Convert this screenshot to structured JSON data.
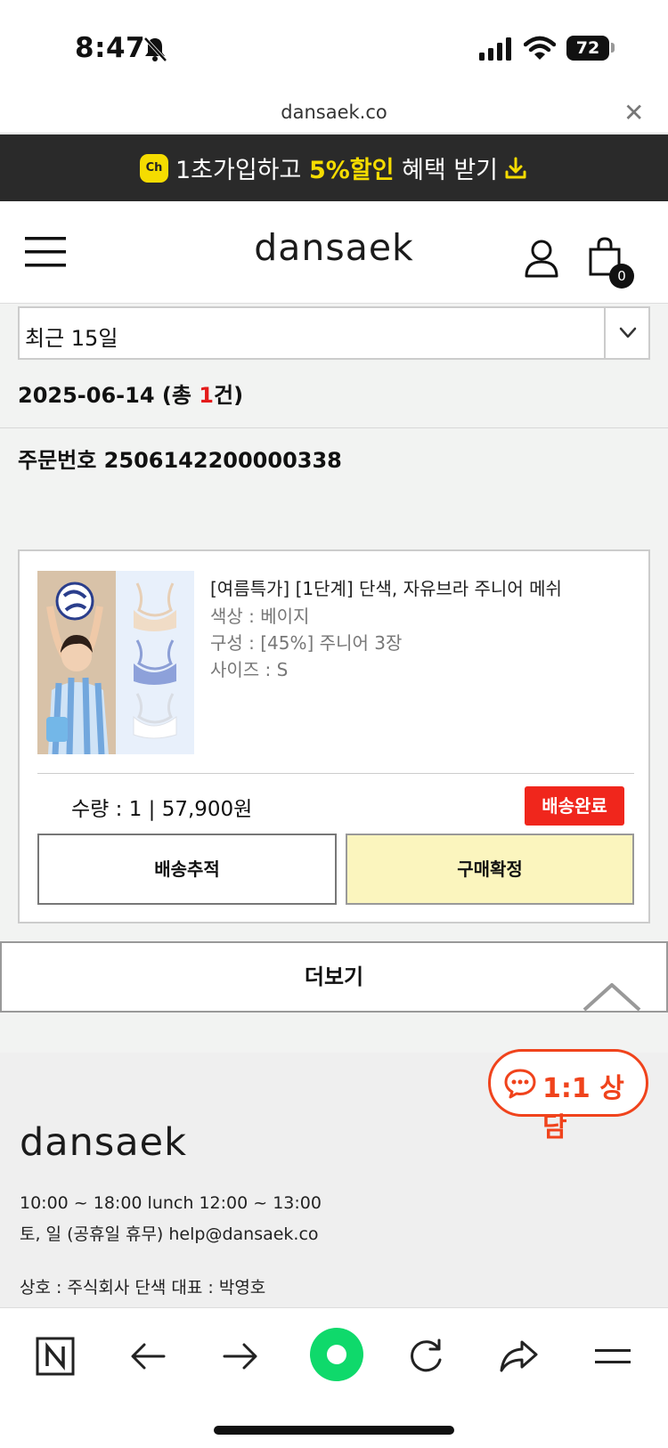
{
  "status_bar": {
    "time": "8:47",
    "battery": "72"
  },
  "url_bar": {
    "domain": "dansaek.co"
  },
  "promo": {
    "ch_badge": "Ch",
    "prefix": "1초가입하고 ",
    "highlight": "5%할인",
    "suffix": " 혜택 받기"
  },
  "header": {
    "logo": "dansaek",
    "cart_count": "0"
  },
  "filter": {
    "period": "최근 15일"
  },
  "order_group": {
    "date": "2025-06-14",
    "count_prefix": " (총 ",
    "count": "1",
    "count_suffix": "건)",
    "order_number": "주문번호 2506142200000338"
  },
  "order_item": {
    "name": "[여름특가] [1단계] 단색, 자유브라 주니어 메쉬",
    "color": "색상 : 베이지",
    "composition": "구성 : [45%] 주니어 3장",
    "size": "사이즈 : S",
    "quantity_price": "수량 : 1 | 57,900원",
    "status": "배송완료",
    "track_button": "배송추적",
    "confirm_button": "구매확정"
  },
  "more_button": "더보기",
  "chat": {
    "label": "1:1 상담"
  },
  "footer": {
    "logo": "dansaek",
    "hours": "10:00 ~ 18:00 lunch 12:00 ~ 13:00",
    "holidays": "토, 일 (공휴일 휴무) help@dansaek.co",
    "company": "상호 : 주식회사 단색 대표 : 박영호"
  },
  "colors": {
    "accent_red": "#f0261c",
    "chat_orange": "#f0431c",
    "promo_yellow": "#f5dc00",
    "confirm_bg": "#fbf5be",
    "naver_green": "#0fd96b"
  }
}
